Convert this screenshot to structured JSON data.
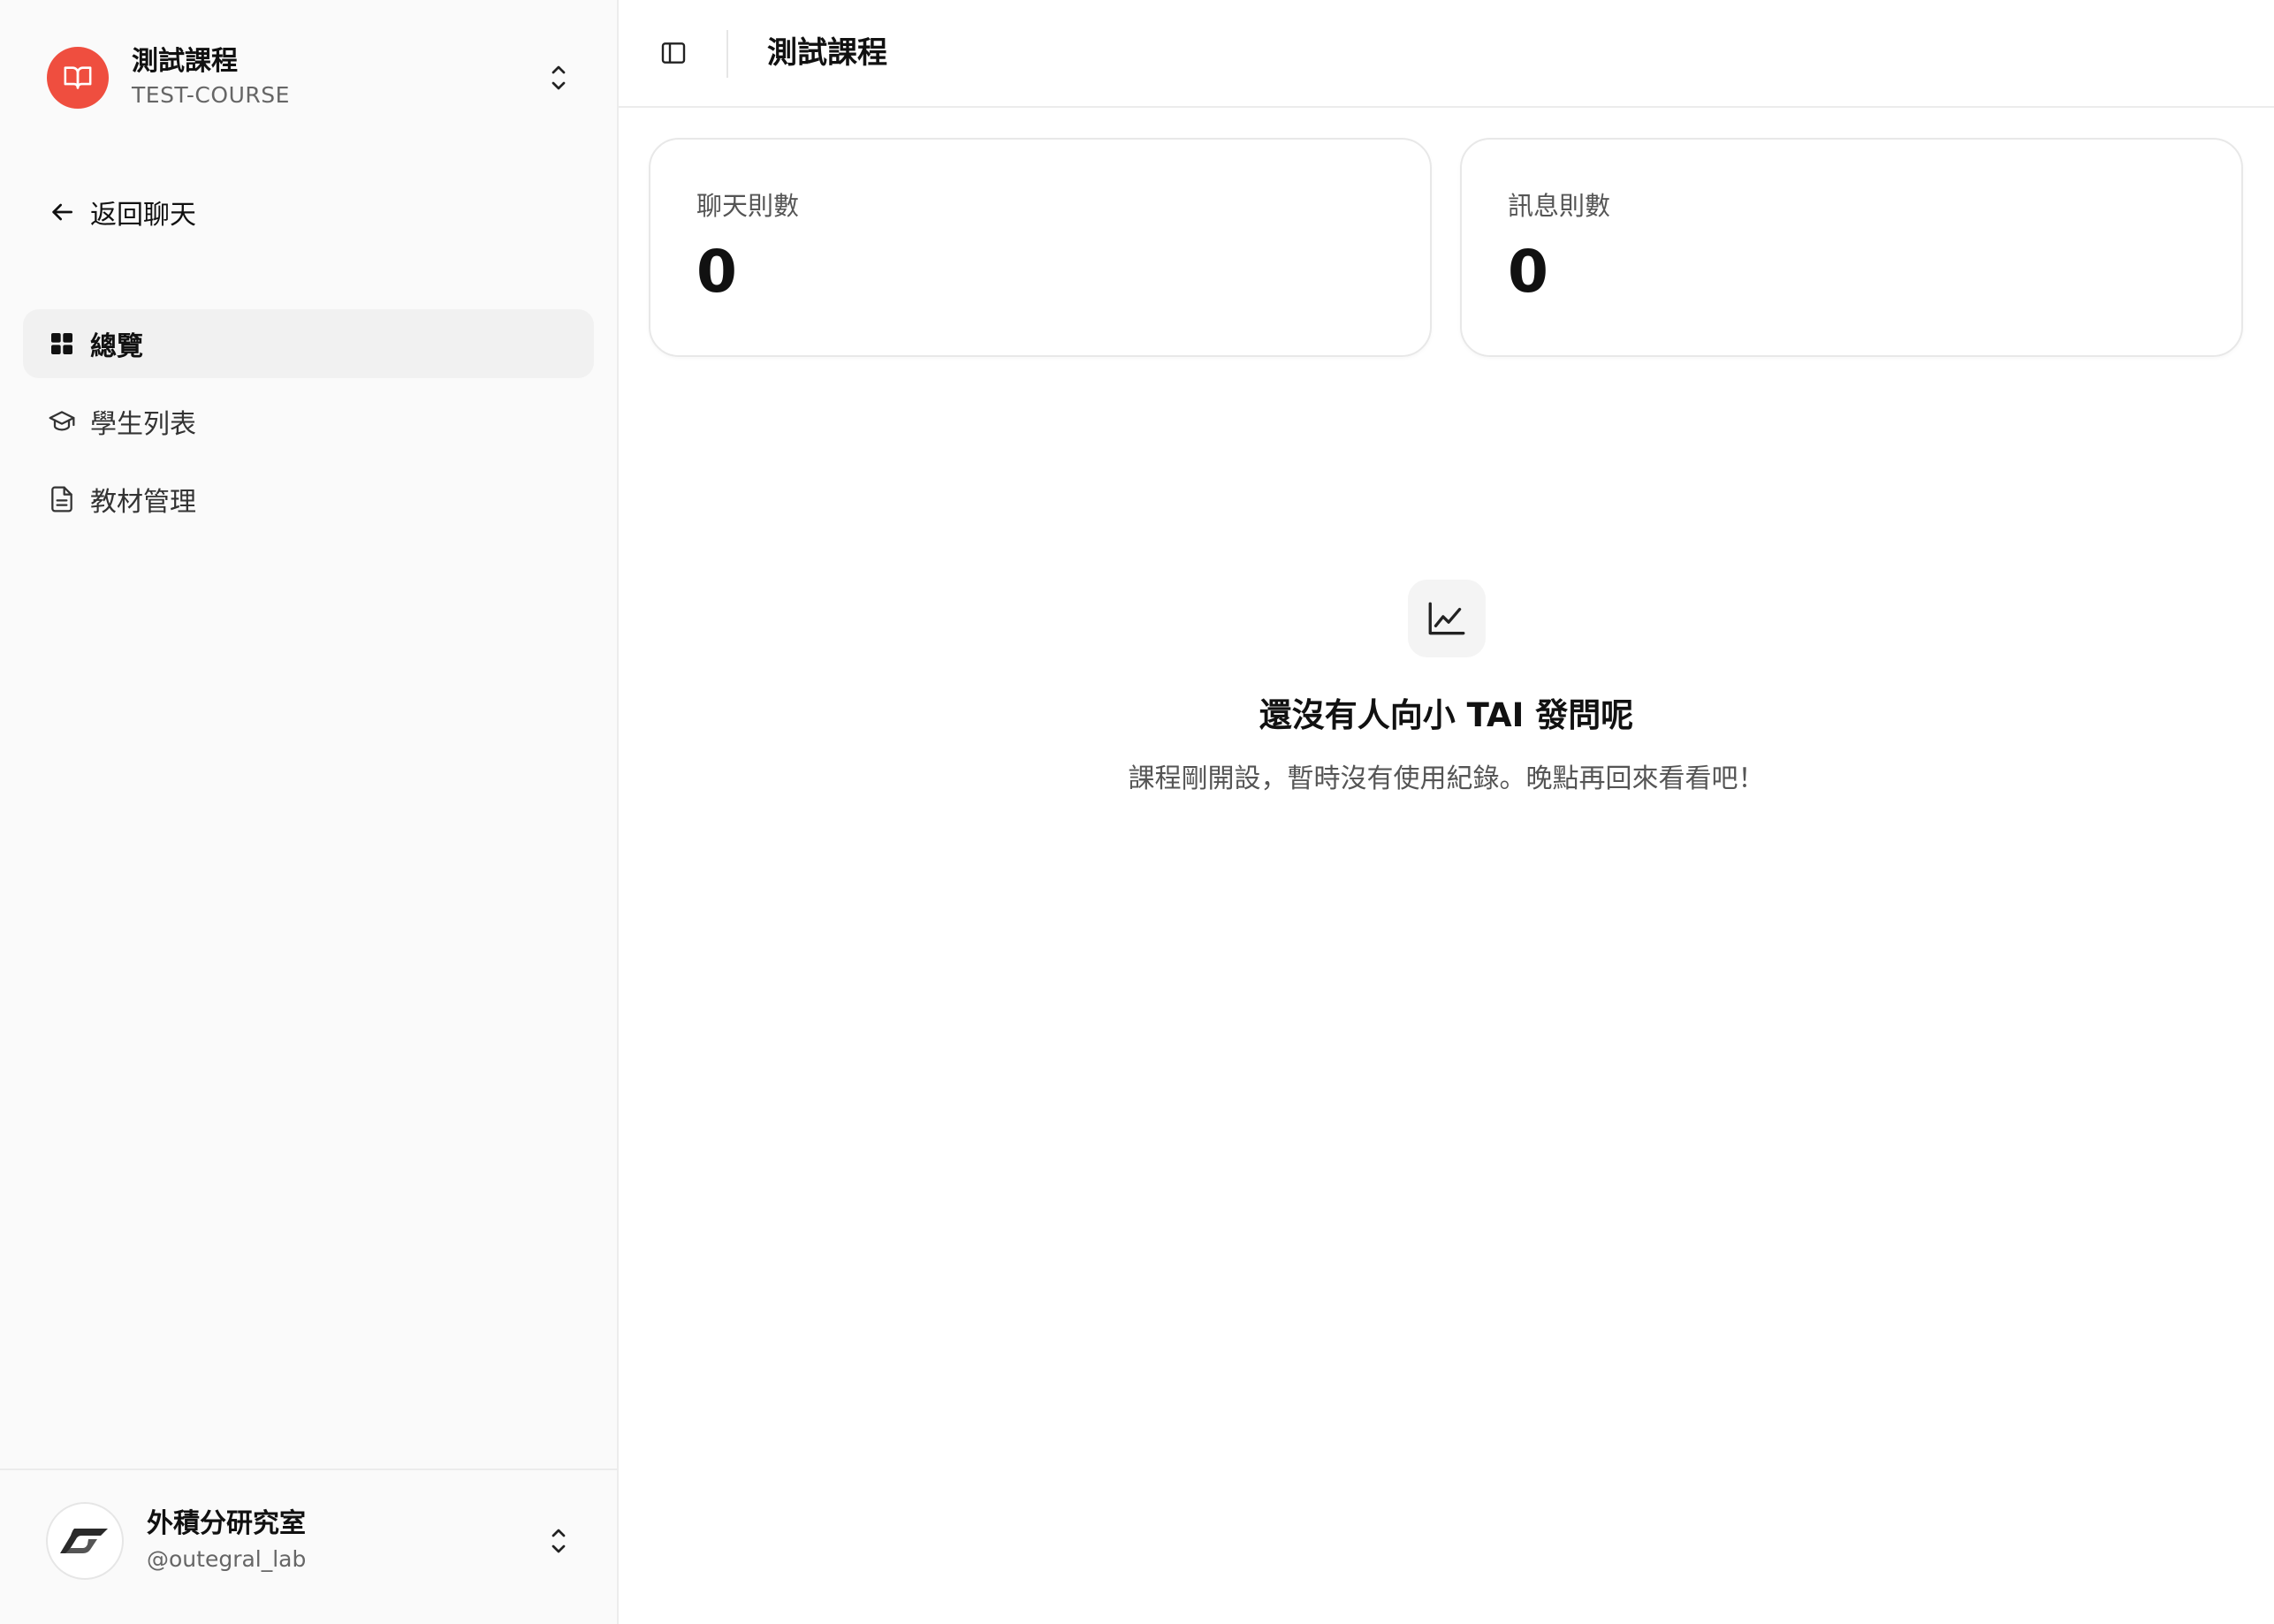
{
  "colors": {
    "accent": "#ef4e3f",
    "sidebar_bg": "#fafafa",
    "border": "#ececec",
    "text_primary": "#111111",
    "text_secondary": "#555555"
  },
  "sidebar": {
    "course": {
      "title": "測試課程",
      "code": "TEST-COURSE",
      "icon": "open-book-icon",
      "switch_icon": "chevron-up-down-icon"
    },
    "back": {
      "label": "返回聊天",
      "icon": "arrow-left-icon"
    },
    "nav": [
      {
        "label": "總覽",
        "icon": "grid-icon",
        "active": true
      },
      {
        "label": "學生列表",
        "icon": "graduation-cap-icon",
        "active": false
      },
      {
        "label": "教材管理",
        "icon": "document-icon",
        "active": false
      }
    ],
    "footer": {
      "org_name": "外積分研究室",
      "handle": "@outegral_lab",
      "avatar_icon": "outegral-logo-icon",
      "switch_icon": "chevron-up-down-icon"
    }
  },
  "header": {
    "title": "測試課程",
    "toggle_icon": "sidebar-toggle-icon"
  },
  "stats": [
    {
      "label": "聊天則數",
      "value": "0"
    },
    {
      "label": "訊息則數",
      "value": "0"
    }
  ],
  "empty_state": {
    "icon": "line-chart-icon",
    "title": "還沒有人向小 TAI 發問呢",
    "description": "課程剛開設，暫時沒有使用紀錄。晚點再回來看看吧！"
  }
}
